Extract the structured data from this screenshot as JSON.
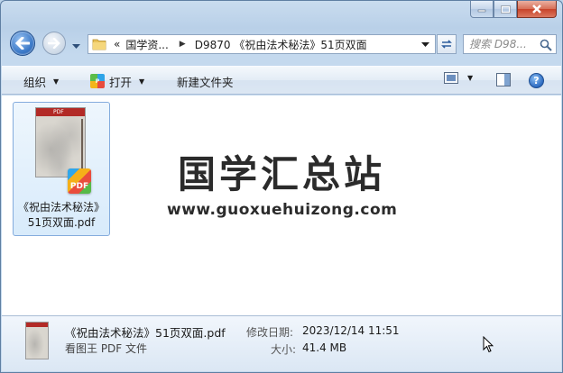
{
  "window": {
    "caption_buttons": [
      "minimize-icon",
      "maximize-icon",
      "close-icon"
    ]
  },
  "navigation": {
    "breadcrumb_overflow": "«",
    "breadcrumb": [
      "国学资...",
      "D9870 《祝由法术秘法》51页双面"
    ],
    "search_placeholder": "搜索 D98..."
  },
  "toolbar": {
    "organize_label": "组织",
    "open_label": "打开",
    "new_folder_label": "新建文件夹",
    "help_label": "?"
  },
  "files": [
    {
      "name_line1": "《祝由法术秘法》",
      "name_line2": "51页双面.pdf",
      "thumb_header": "PDF",
      "badge": "PDF"
    }
  ],
  "watermark": {
    "title": "国学汇总站",
    "url": "www.guoxuehuizong.com"
  },
  "details": {
    "file_name": "《祝由法术秘法》51页双面.pdf",
    "file_type": "看图王 PDF 文件",
    "modified_label": "修改日期:",
    "modified_value": "2023/12/14 11:51",
    "size_label": "大小:",
    "size_value": "41.4 MB"
  }
}
